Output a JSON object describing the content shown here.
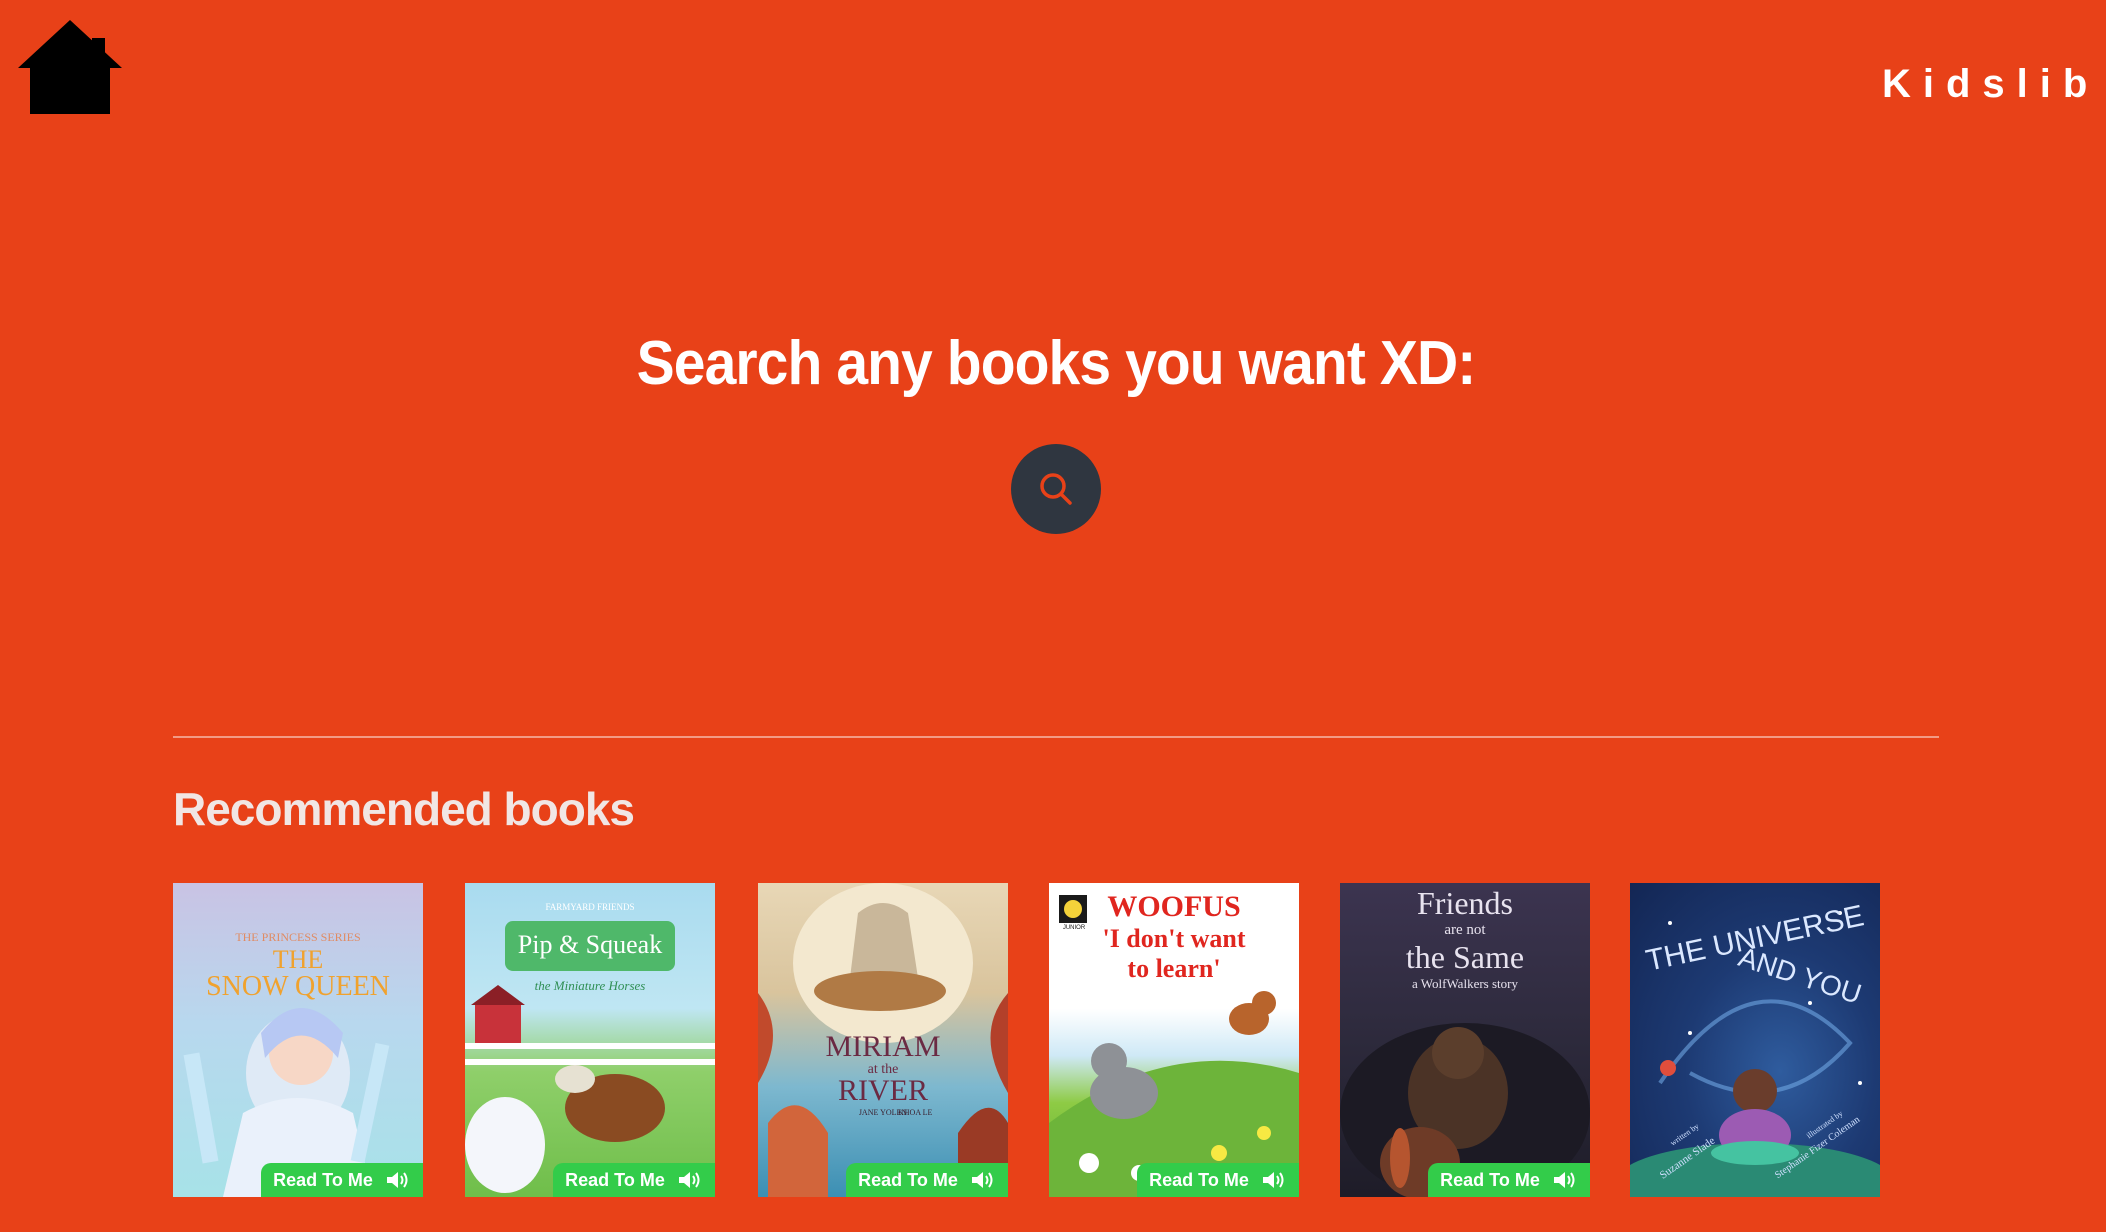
{
  "header": {
    "home_icon": "home-icon",
    "brand": "Kidslib"
  },
  "search": {
    "title": "Search any books you want XD:",
    "button_icon": "search-icon"
  },
  "recommended": {
    "title": "Recommended books",
    "books": [
      {
        "cover_lines": [
          "THE PRINCESS SERIES",
          "THE",
          "SNOW QUEEN"
        ],
        "badge": "Read To Me"
      },
      {
        "cover_lines": [
          "FARMYARD FRIENDS",
          "Pip & Squeak",
          "the Miniature Horses"
        ],
        "badge": "Read To Me"
      },
      {
        "cover_lines": [
          "MIRIAM",
          "at the",
          "RIVER",
          "JANE YOLEN",
          "KHOA LE"
        ],
        "badge": "Read To Me"
      },
      {
        "cover_lines": [
          "JUNIOR",
          "WOOFUS",
          "'I don't want",
          "to learn'"
        ],
        "badge": "Read To Me"
      },
      {
        "cover_lines": [
          "Friends",
          "are not",
          "the Same",
          "a WolfWalkers story"
        ],
        "badge": "Read To Me"
      },
      {
        "cover_lines": [
          "THE UNIVERSE",
          "AND YOU",
          "written by",
          "Suzanne Slade",
          "illustrated by",
          "Stephanie Fizer Coleman"
        ],
        "badge": null
      }
    ]
  },
  "colors": {
    "background": "#e84118",
    "search_button": "#2f3640",
    "badge": "#33cc4a",
    "text": "#ffffff"
  }
}
